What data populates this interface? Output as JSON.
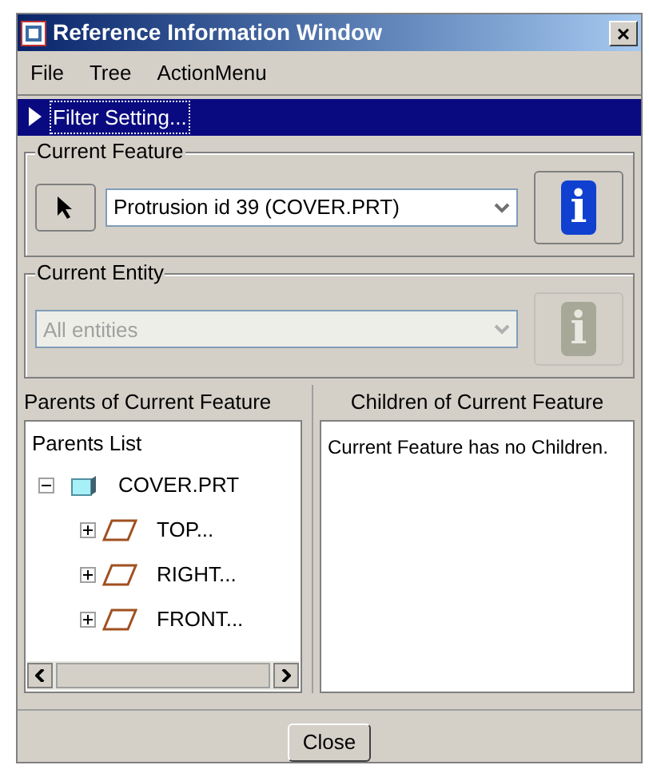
{
  "window": {
    "title": "Reference Information Window",
    "close": "×"
  },
  "menu": [
    "File",
    "Tree",
    "ActionMenu"
  ],
  "filter_bar": {
    "label": "Filter Setting...",
    "expanded": false
  },
  "current_feature": {
    "legend": "Current Feature",
    "value": "Protrusion id 39 (COVER.PRT)",
    "disabled": false,
    "info": "i"
  },
  "current_entity": {
    "legend": "Current Entity",
    "value": "All entities",
    "disabled": true,
    "info": "i"
  },
  "parents": {
    "header": "Parents of Current Feature",
    "list_title": "Parents List",
    "tree": [
      {
        "label": "COVER.PRT",
        "kind": "part",
        "expanded": true,
        "children": [
          {
            "label": "TOP...",
            "kind": "plane",
            "expanded": false
          },
          {
            "label": "RIGHT...",
            "kind": "plane",
            "expanded": false
          },
          {
            "label": "FRONT...",
            "kind": "plane",
            "expanded": false
          }
        ]
      }
    ]
  },
  "children": {
    "header": "Children of Current Feature",
    "message": "Current Feature has no Children."
  },
  "buttons": [
    "Close"
  ]
}
